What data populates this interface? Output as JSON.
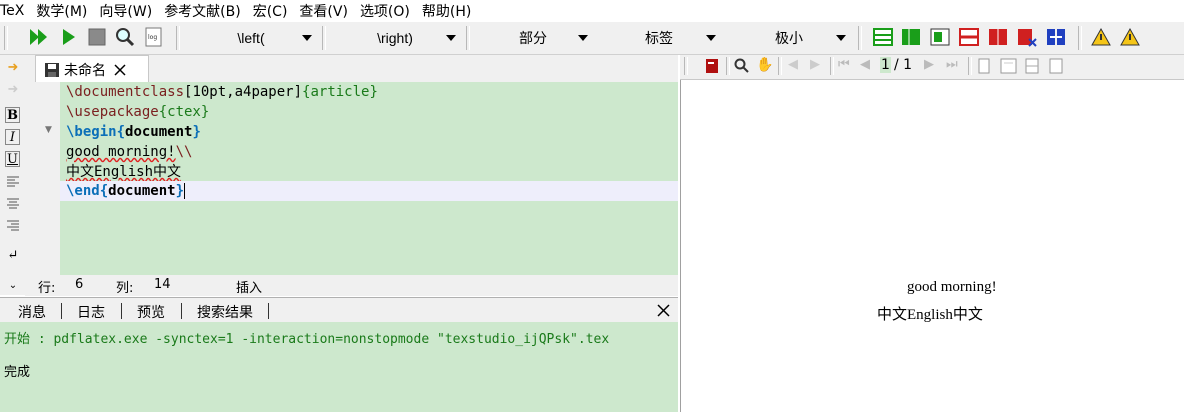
{
  "menu": [
    "TeX",
    "数学(M)",
    "向导(W)",
    "参考文献(B)",
    "宏(C)",
    "查看(V)",
    "选项(O)",
    "帮助(H)"
  ],
  "toolbar": {
    "left_combo": "\\left(",
    "right_combo": "\\right)",
    "section_combo": "部分",
    "label_combo": "标签",
    "size_combo": "极小",
    "log_label": "log"
  },
  "editor": {
    "tab_title": "未命名",
    "lines": [
      {
        "cmd": "\\documentclass",
        "opt": "[10pt,a4paper]",
        "arg": "{article}"
      },
      {
        "cmd": "\\usepackage",
        "arg": "{ctex}"
      },
      {
        "cmd": "\\begin",
        "arg": "document"
      },
      {
        "text": "good morning!",
        "tail": "\\\\"
      },
      {
        "text": "中文English中文"
      },
      {
        "cmd": "\\end",
        "arg": "document"
      }
    ]
  },
  "status": {
    "row_label": "行:",
    "row": "6",
    "col_label": "列:",
    "col": "14",
    "mode": "插入"
  },
  "messages": {
    "tabs": [
      "消息",
      "日志",
      "预览",
      "搜索结果"
    ],
    "start_line": "开始 : pdflatex.exe -synctex=1 -interaction=nonstopmode \"texstudio_ijQPsk\".tex",
    "done": "完成"
  },
  "pdf": {
    "page": "1",
    "total": "/ 1",
    "line1": "good morning!",
    "line2": "中文English中文"
  },
  "colors": {
    "editor_bg": "#cde8cd",
    "current_line": "#eeeefb",
    "accent_green": "#1a9e1a"
  }
}
